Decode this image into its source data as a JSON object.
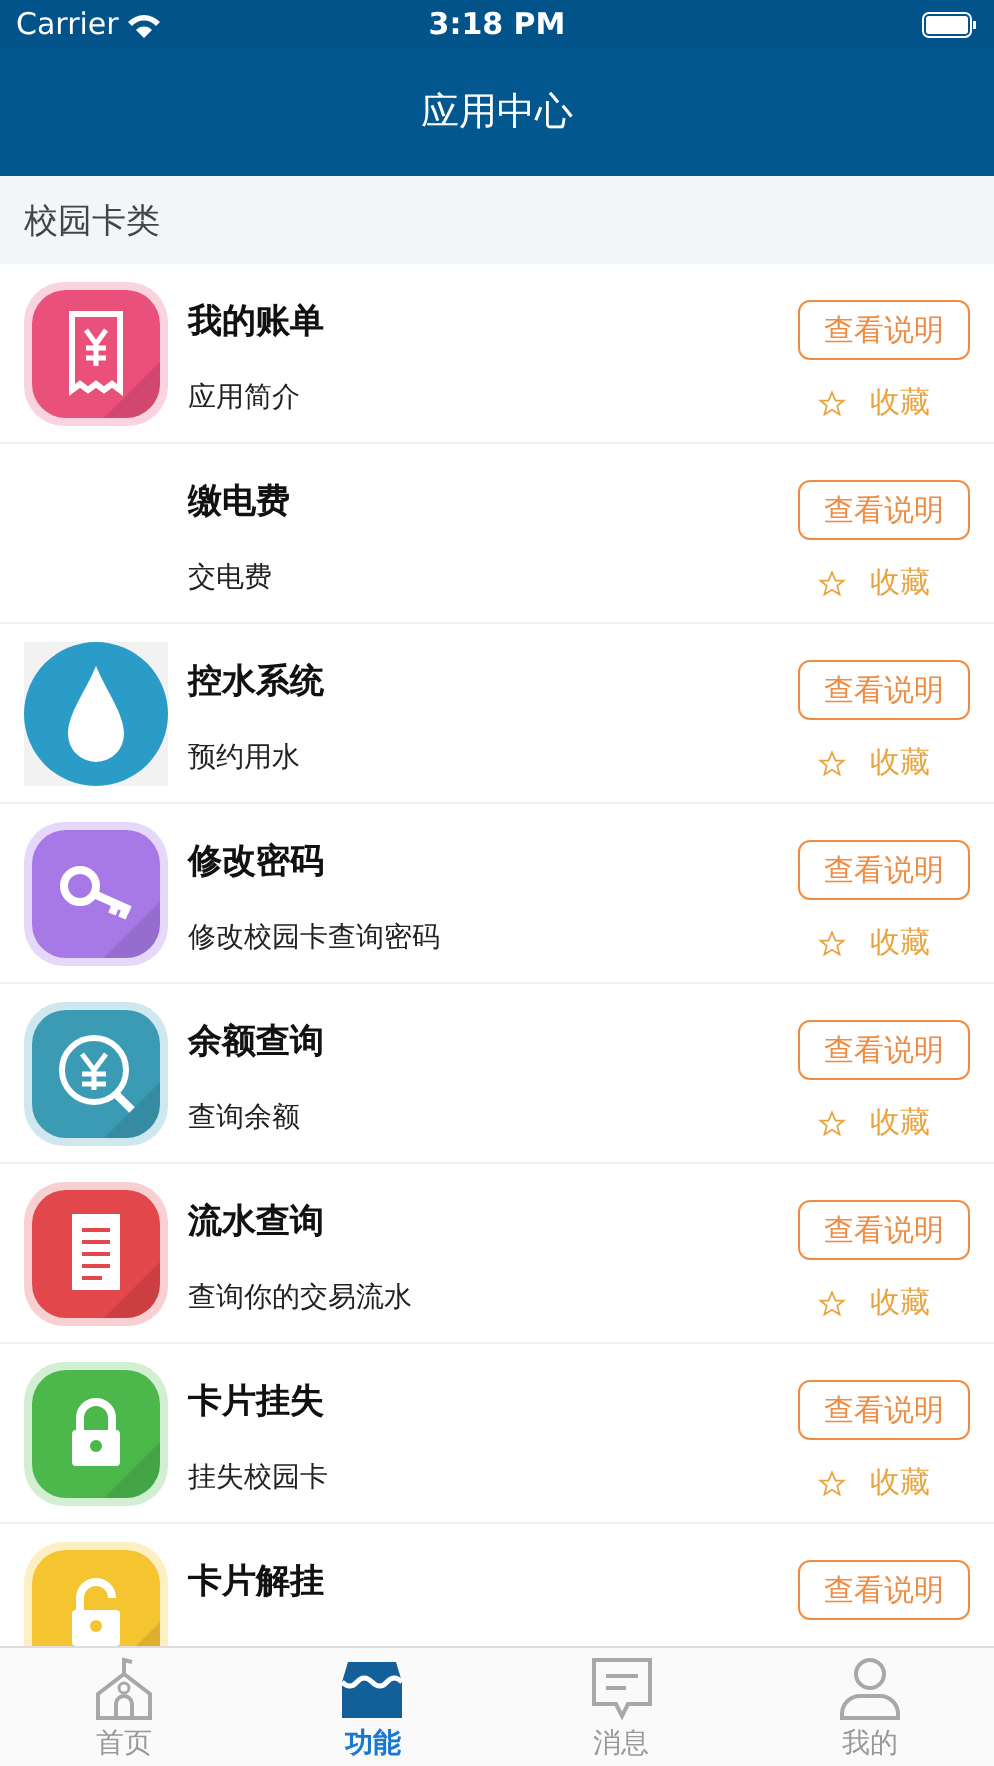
{
  "status_bar": {
    "carrier": "Carrier",
    "time": "3:18 PM"
  },
  "nav": {
    "title": "应用中心"
  },
  "section": {
    "title": "校园卡类"
  },
  "apps": [
    {
      "kind": "receipt",
      "title": "我的账单",
      "subtitle": "应用简介",
      "button": "查看说明",
      "favorite": "收藏"
    },
    {
      "kind": "blank",
      "title": "缴电费",
      "subtitle": "交电费",
      "button": "查看说明",
      "favorite": "收藏"
    },
    {
      "kind": "drop",
      "title": "控水系统",
      "subtitle": "预约用水",
      "button": "查看说明",
      "favorite": "收藏"
    },
    {
      "kind": "key",
      "title": "修改密码",
      "subtitle": "修改校园卡查询密码",
      "button": "查看说明",
      "favorite": "收藏"
    },
    {
      "kind": "yen",
      "title": "余额查询",
      "subtitle": "查询余额",
      "button": "查看说明",
      "favorite": "收藏"
    },
    {
      "kind": "list",
      "title": "流水查询",
      "subtitle": "查询你的交易流水",
      "button": "查看说明",
      "favorite": "收藏"
    },
    {
      "kind": "lock",
      "title": "卡片挂失",
      "subtitle": "挂失校园卡",
      "button": "查看说明",
      "favorite": "收藏"
    },
    {
      "kind": "unlock",
      "title": "卡片解挂",
      "button": "查看说明"
    }
  ],
  "tabs": [
    {
      "kind": "home",
      "label": "首页",
      "selected": false
    },
    {
      "kind": "store",
      "label": "功能",
      "selected": true
    },
    {
      "kind": "message",
      "label": "消息",
      "selected": false
    },
    {
      "kind": "person",
      "label": "我的",
      "selected": false
    }
  ]
}
